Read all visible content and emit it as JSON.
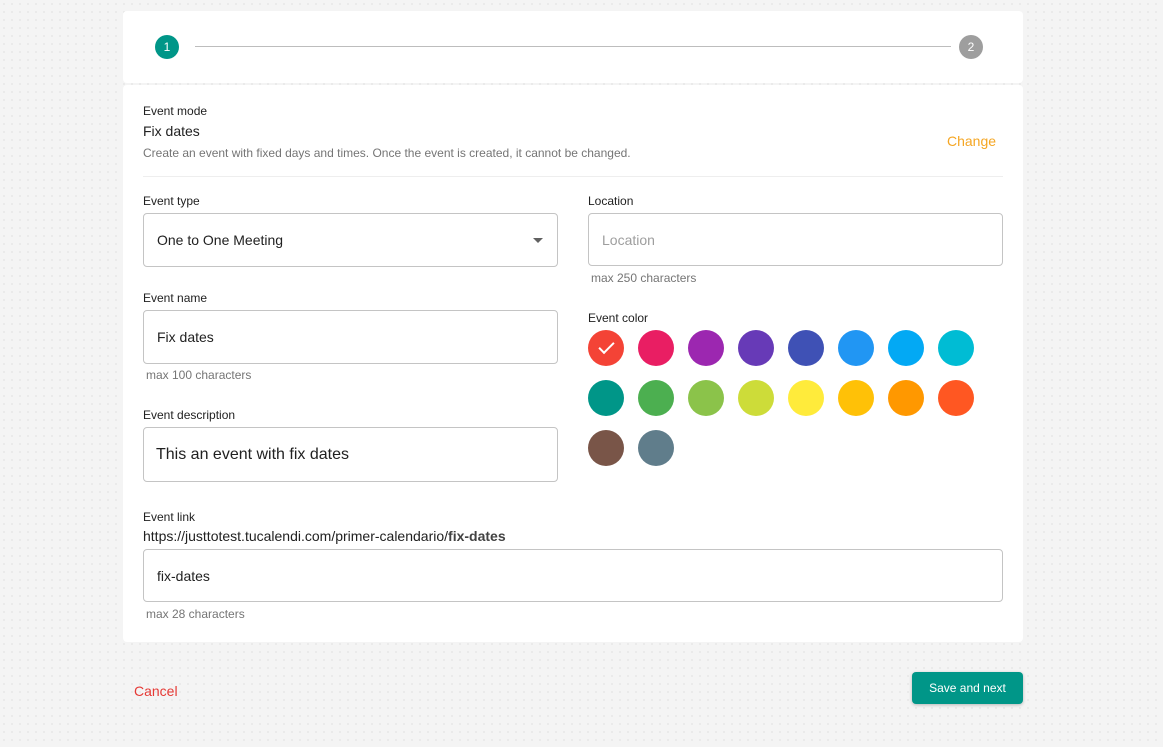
{
  "stepper": {
    "step1": "1",
    "step2": "2"
  },
  "mode": {
    "label": "Event mode",
    "value": "Fix dates",
    "description": "Create an event with fixed days and times. Once the event is created, it cannot be changed.",
    "change_label": "Change"
  },
  "event_type": {
    "label": "Event type",
    "value": "One to One Meeting"
  },
  "location": {
    "label": "Location",
    "placeholder": "Location",
    "counter": "max 250 characters"
  },
  "event_name": {
    "label": "Event name",
    "value": "Fix dates",
    "counter": "max 100 characters"
  },
  "event_color": {
    "label": "Event color",
    "selected": "#f44336",
    "colors": [
      "#f44336",
      "#e91e63",
      "#9c27b0",
      "#673ab7",
      "#3f51b5",
      "#2196f3",
      "#03a9f4",
      "#00bcd4",
      "#009688",
      "#4caf50",
      "#8bc34a",
      "#cddc39",
      "#ffeb3b",
      "#ffc107",
      "#ff9800",
      "#ff5722",
      "#795548",
      "#607d8b"
    ]
  },
  "event_description": {
    "label": "Event description",
    "value": "This an event with fix dates"
  },
  "event_link": {
    "label": "Event link",
    "url_base": "https://justtotest.tucalendi.com/primer-calendario/",
    "url_slug": "fix-dates",
    "value": "fix-dates",
    "counter": "max 28 characters"
  },
  "actions": {
    "cancel_label": "Cancel",
    "save_label": "Save and next"
  }
}
